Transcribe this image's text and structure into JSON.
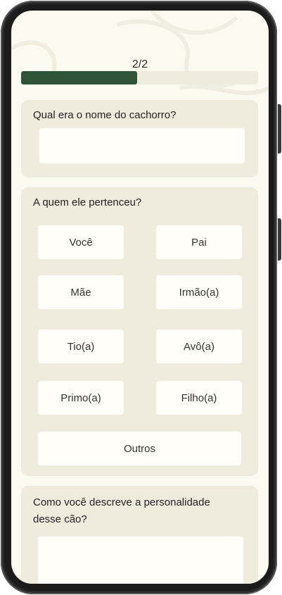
{
  "progress": {
    "label": "2/2",
    "fraction": 0.49
  },
  "questions": {
    "dog_name": {
      "label": "Qual era o nome do cachorro?",
      "value": ""
    },
    "owner": {
      "label": "A quem ele pertenceu?",
      "options": [
        "Você",
        "Pai",
        "Mãe",
        "Irmão(a)",
        "Tio(a)",
        "Avô(a)",
        "Primo(a)",
        "Filho(a)",
        "Outros"
      ]
    },
    "personality": {
      "label_line1": "Como você descreve a personalidade",
      "label_line2": "desse cão?",
      "value": ""
    }
  }
}
